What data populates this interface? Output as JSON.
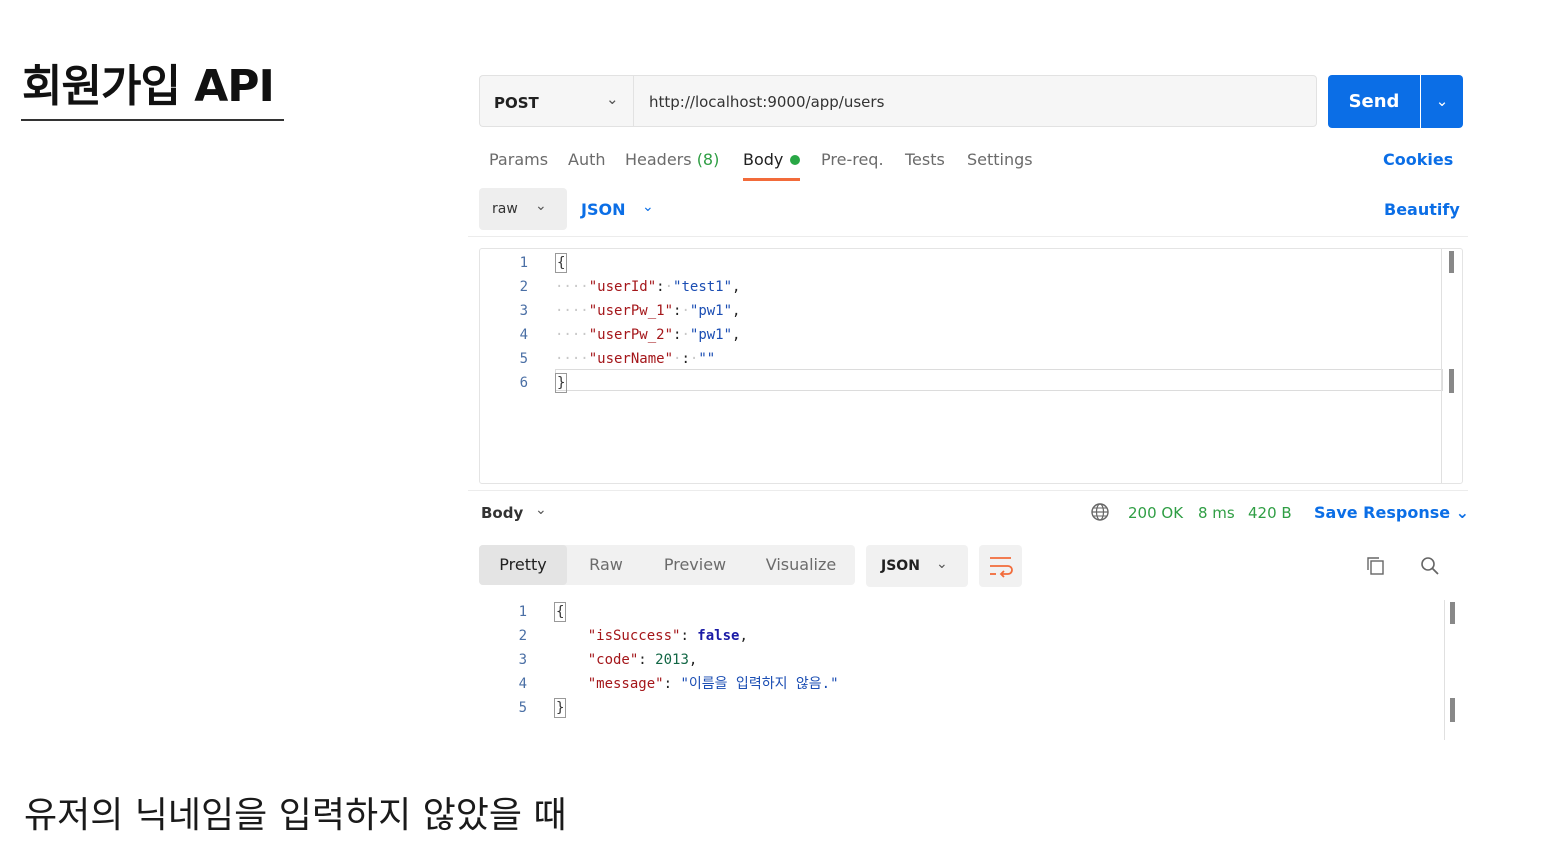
{
  "slide": {
    "title": "회원가입 API",
    "caption": "유저의 닉네임을 입력하지 않았을 때"
  },
  "request": {
    "method": "POST",
    "url": "http://localhost:9000/app/users",
    "send_label": "Send",
    "tabs": {
      "params": "Params",
      "auth": "Auth",
      "headers": "Headers",
      "headers_count": "(8)",
      "body": "Body",
      "prereq": "Pre-req.",
      "tests": "Tests",
      "settings": "Settings"
    },
    "cookies": "Cookies",
    "body_mode": "raw",
    "body_format": "JSON",
    "beautify": "Beautify",
    "code": [
      {
        "ln": "1",
        "key": "",
        "val": ""
      },
      {
        "ln": "2",
        "key": "\"userId\"",
        "val": "\"test1\""
      },
      {
        "ln": "3",
        "key": "\"userPw_1\"",
        "val": "\"pw1\""
      },
      {
        "ln": "4",
        "key": "\"userPw_2\"",
        "val": "\"pw1\""
      },
      {
        "ln": "5",
        "key": "\"userName\"",
        "val": "\"\""
      },
      {
        "ln": "6",
        "key": "",
        "val": ""
      }
    ]
  },
  "response": {
    "body_label": "Body",
    "status": "200 OK",
    "time": "8 ms",
    "size": "420 B",
    "save_response": "Save Response",
    "views": [
      "Pretty",
      "Raw",
      "Preview",
      "Visualize"
    ],
    "format": "JSON",
    "code": {
      "l1": "1",
      "l2": "2",
      "l3": "3",
      "l4": "4",
      "l5": "5",
      "isSuccess_key": "\"isSuccess\"",
      "isSuccess_val": "false",
      "code_key": "\"code\"",
      "code_val": "2013",
      "message_key": "\"message\"",
      "message_val": "\"이름을 입력하지 않음.\""
    }
  },
  "colors": {
    "accent": "#0b6ee6",
    "tab_underline": "#f26b3a",
    "status_green": "#2f9e44"
  }
}
